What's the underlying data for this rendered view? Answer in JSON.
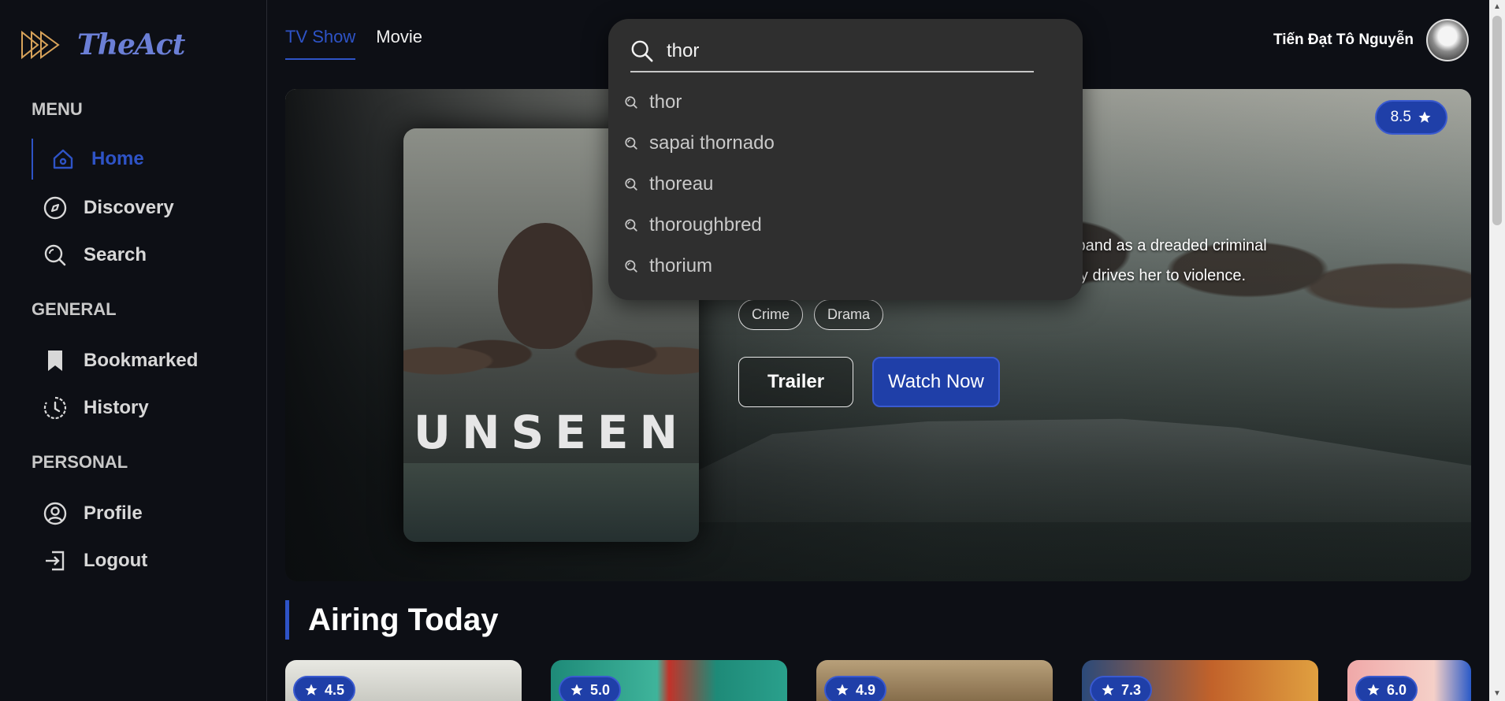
{
  "app": {
    "name": "TheAct"
  },
  "sidebar": {
    "menu_title": "MENU",
    "general_title": "GENERAL",
    "personal_title": "PERSONAL",
    "menu_items": [
      {
        "label": "Home",
        "icon": "home-icon"
      },
      {
        "label": "Discovery",
        "icon": "compass-icon"
      },
      {
        "label": "Search",
        "icon": "search-icon"
      }
    ],
    "general_items": [
      {
        "label": "Bookmarked",
        "icon": "bookmark-icon"
      },
      {
        "label": "History",
        "icon": "clock-icon"
      }
    ],
    "personal_items": [
      {
        "label": "Profile",
        "icon": "user-icon"
      },
      {
        "label": "Logout",
        "icon": "logout-icon"
      }
    ]
  },
  "topnav": {
    "tabs": [
      {
        "label": "TV Show"
      },
      {
        "label": "Movie"
      }
    ]
  },
  "user": {
    "name": "Tiến Đạt Tô Nguyễn"
  },
  "search": {
    "value": "thor",
    "suggestions": [
      "thor",
      "sapai thornado",
      "thoreau",
      "thoroughbred",
      "thorium"
    ]
  },
  "hero": {
    "poster_title": "UNSEEN",
    "rating": "8.5",
    "overview_line1": "r husband as a dreaded criminal",
    "overview_line2": "mately drives her to violence.",
    "genres": [
      "Crime",
      "Drama"
    ],
    "trailer_label": "Trailer",
    "watch_label": "Watch Now"
  },
  "airing_today": {
    "title": "Airing Today",
    "ratings": [
      "4.5",
      "5.0",
      "4.9",
      "7.3",
      "6.0"
    ]
  },
  "colors": {
    "accent": "#2e53c6",
    "badge": "#1f3fa8",
    "background": "#0d0f15",
    "panel": "#2f2f2f"
  }
}
